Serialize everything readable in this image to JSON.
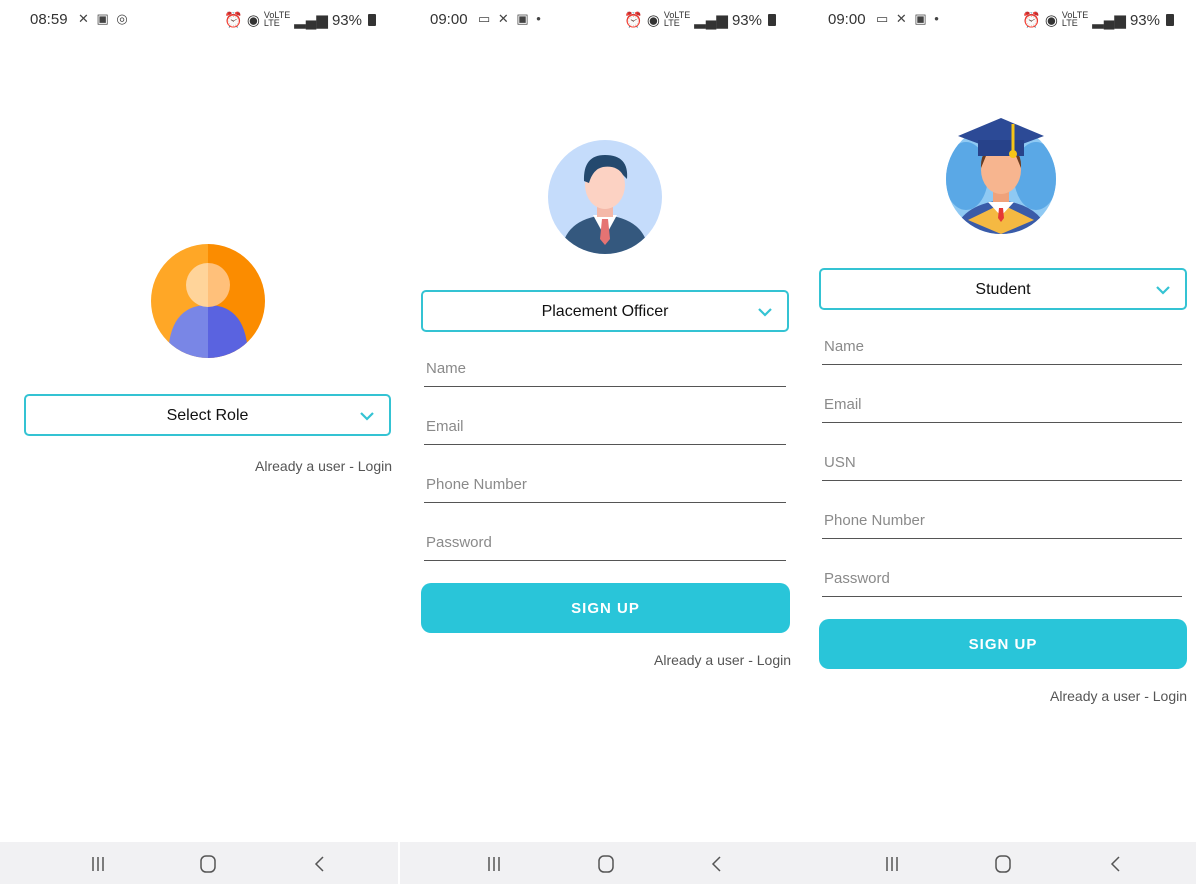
{
  "screens": [
    {
      "status": {
        "time": "08:59",
        "left_icons": "✕ ▣ ◎",
        "battery": "93%"
      },
      "role_select": {
        "selected": "Select Role"
      },
      "login_link": "Already a user - Login"
    },
    {
      "status": {
        "time": "09:00",
        "left_icons": "▭ ✕ ▣ •",
        "battery": "93%"
      },
      "role_select": {
        "selected": "Placement Officer"
      },
      "fields": {
        "name": "Name",
        "email": "Email",
        "phone": "Phone Number",
        "password": "Password"
      },
      "signup_label": "SIGN UP",
      "login_link": "Already a user - Login"
    },
    {
      "status": {
        "time": "09:00",
        "left_icons": "▭ ✕ ▣ •",
        "battery": "93%"
      },
      "role_select": {
        "selected": "Student"
      },
      "fields": {
        "name": "Name",
        "email": "Email",
        "usn": "USN",
        "phone": "Phone Number",
        "password": "Password"
      },
      "signup_label": "SIGN UP",
      "login_link": "Already a user - Login"
    }
  ],
  "status_bar": {
    "network": "LTE",
    "volte": "VoLTE"
  },
  "icons": {
    "alarm": "alarm-icon",
    "hotspot": "hotspot-icon",
    "signal": "signal-icon",
    "battery": "battery-icon",
    "recents": "recents-nav-icon",
    "home": "home-nav-icon",
    "back": "back-nav-icon",
    "chevron": "chevron-down-icon"
  },
  "colors": {
    "accent": "#29c5d9",
    "outline": "#34c3d3",
    "navbar": "#f1f1f3"
  }
}
